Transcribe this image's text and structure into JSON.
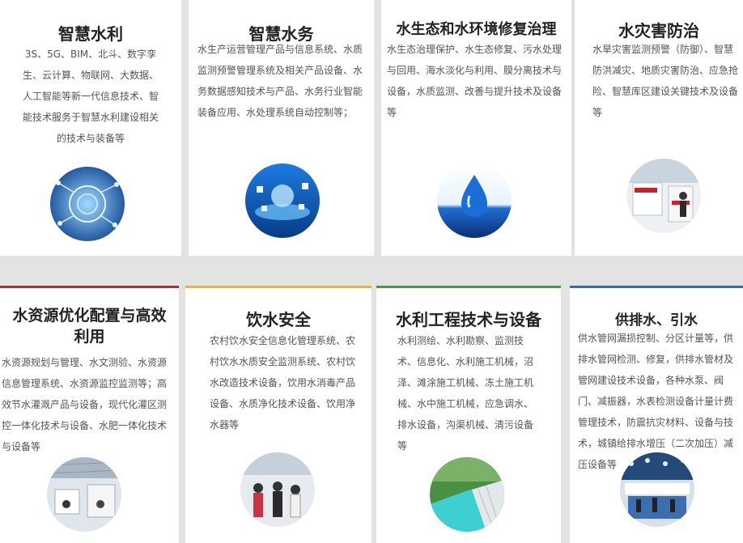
{
  "cards_top": [
    {
      "title": "智慧水利",
      "desc": "3S、5G、BIM、北斗、数字孪生、云计算、物联网、大数据、人工智能等新一代信息技术、智能技术服务于智慧水利建设相关的技术与装备等",
      "icon": "data-network-image"
    },
    {
      "title": "智慧水务",
      "desc": "水生产运营管理产品与信息系统、水质监测预警管理系统及相关产品设备、水务数据感知技术与产品、水务行业智能装备应用、水处理系统自动控制等；",
      "icon": "smart-water-image"
    },
    {
      "title": "水生态和水环境修复治理",
      "desc": "水生态治理保护、水生态修复、污水处理与回用、海水淡化与利用、膜分离技术与设备，水质监测、改善与提升技术及设备等",
      "icon": "water-drop-image"
    },
    {
      "title": "水灾害防治",
      "desc": "水旱灾害监测预警（防御）、智慧防洪减灾、地质灾害防治、应急抢险、智慧库区建设关键技术及设备等",
      "icon": "exhibition-booth-image"
    }
  ],
  "cards_bottom": [
    {
      "title": "水资源优化配置与高效利用",
      "desc": "水资源规划与管理、水文测验、水资源信息管理系统、水资源监控监测等；高效节水灌溉产品与设备，现代化灌区测控一体化技术与设备、水肥一体化技术与设备等",
      "icon": "exhibition-hall-image",
      "accent": "#c8232c"
    },
    {
      "title": "饮水安全",
      "desc": "农村饮水安全信息化管理系统、农村饮水水质安全监测系统、农村饮水改造技术设备，饮用水消毒产品设备、水质净化技术设备、饮用净水器等",
      "icon": "visitors-image",
      "accent": "#f2b418"
    },
    {
      "title": "水利工程技术与设备",
      "desc": "水利测绘、水利勘察、监测技术、信息化、水利施工机械，沼泽、滩涂施工机械、冻土施工机械、水中施工机械，应急调水、排水设备，沟渠机械、清污设备等",
      "icon": "dam-image",
      "accent": "#3aa635"
    },
    {
      "title": "供排水、引水",
      "desc": "供水管网漏损控制、分区计量等，供排水管网检测、修复，供排水管材及管网建设技术设备，各种水泵、阀门、减振器，水表检测设备计量计费管理技术，防震抗灾材料、设备与技术，城镇给排水增压（二次加压）减压设备等",
      "icon": "exhibition-stand-image",
      "accent": "#1f6fc5"
    }
  ]
}
